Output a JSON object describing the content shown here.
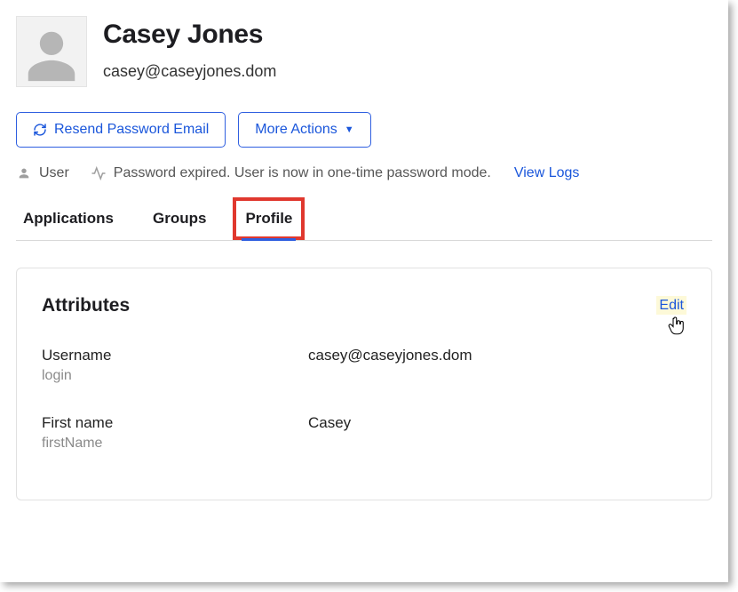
{
  "header": {
    "name": "Casey Jones",
    "email": "casey@caseyjones.dom"
  },
  "actions": {
    "resend_label": "Resend Password Email",
    "more_actions_label": "More Actions"
  },
  "status": {
    "role": "User",
    "message": "Password expired. User is now in one-time password mode.",
    "view_logs": "View Logs"
  },
  "tabs": {
    "applications": "Applications",
    "groups": "Groups",
    "profile": "Profile"
  },
  "panel": {
    "title": "Attributes",
    "edit": "Edit"
  },
  "attributes": [
    {
      "label": "Username",
      "key": "login",
      "value": "casey@caseyjones.dom"
    },
    {
      "label": "First name",
      "key": "firstName",
      "value": "Casey"
    }
  ]
}
